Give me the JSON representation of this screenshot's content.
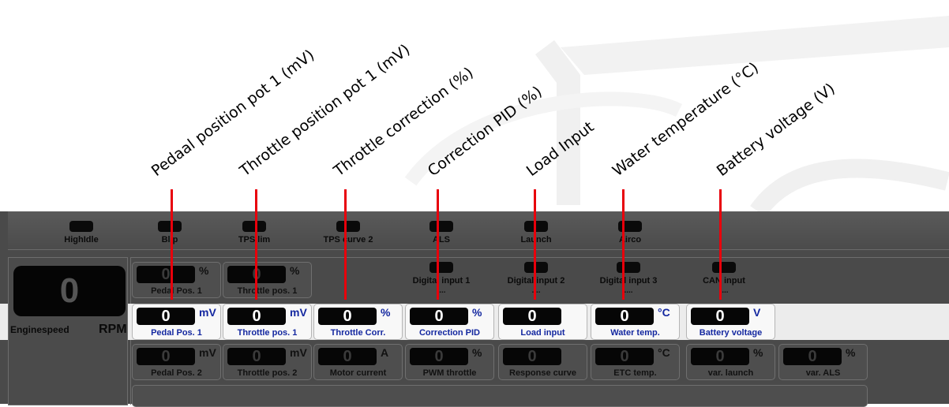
{
  "annotations": [
    "Pedaal position pot 1 (mV)",
    "Throttle position pot 1 (mV)",
    "Throttle correction (%)",
    "Correction PID (%)",
    "Load Input",
    "Water temperature (°C)",
    "Battery voltage (V)"
  ],
  "colors": {
    "arrow": "#e8000b",
    "highlight_text": "#1428a0",
    "panel": "#4a4a4a"
  },
  "top_indicators": [
    "HighIdle",
    "Blip",
    "TPS lim",
    "TPS curve 2",
    "ALS",
    "Launch",
    "Airco"
  ],
  "digital_inputs": [
    {
      "label": "Digital input 1",
      "value": "...."
    },
    {
      "label": "Digital input 2",
      "value": "...."
    },
    {
      "label": "Digital input 3",
      "value": "...."
    },
    {
      "label": "CAN input",
      "value": "...."
    }
  ],
  "engine": {
    "value": "0",
    "label": "Enginespeed",
    "unit": "RPM"
  },
  "row1": [
    {
      "value": "0",
      "unit": "%",
      "label": "Pedal Pos. 1"
    },
    {
      "value": "0",
      "unit": "%",
      "label": "Throttle pos. 1"
    }
  ],
  "row2": [
    {
      "value": "0",
      "unit": "mV",
      "label": "Pedal Pos. 1"
    },
    {
      "value": "0",
      "unit": "mV",
      "label": "Throttle pos. 1"
    },
    {
      "value": "0",
      "unit": "%",
      "label": "Throttle Corr."
    },
    {
      "value": "0",
      "unit": "%",
      "label": "Correction PID"
    },
    {
      "value": "0",
      "unit": "",
      "label": "Load input"
    },
    {
      "value": "0",
      "unit": "°C",
      "label": "Water temp."
    },
    {
      "value": "0",
      "unit": "V",
      "label": "Battery voltage"
    }
  ],
  "row3": [
    {
      "value": "0",
      "unit": "mV",
      "label": "Pedal Pos. 2"
    },
    {
      "value": "0",
      "unit": "mV",
      "label": "Throttle pos. 2"
    },
    {
      "value": "0",
      "unit": "A",
      "label": "Motor current"
    },
    {
      "value": "0",
      "unit": "%",
      "label": "PWM throttle"
    },
    {
      "value": "0",
      "unit": "",
      "label": "Response curve"
    },
    {
      "value": "0",
      "unit": "°C",
      "label": "ETC temp."
    },
    {
      "value": "0",
      "unit": "%",
      "label": "var. launch"
    },
    {
      "value": "0",
      "unit": "%",
      "label": "var. ALS"
    }
  ]
}
